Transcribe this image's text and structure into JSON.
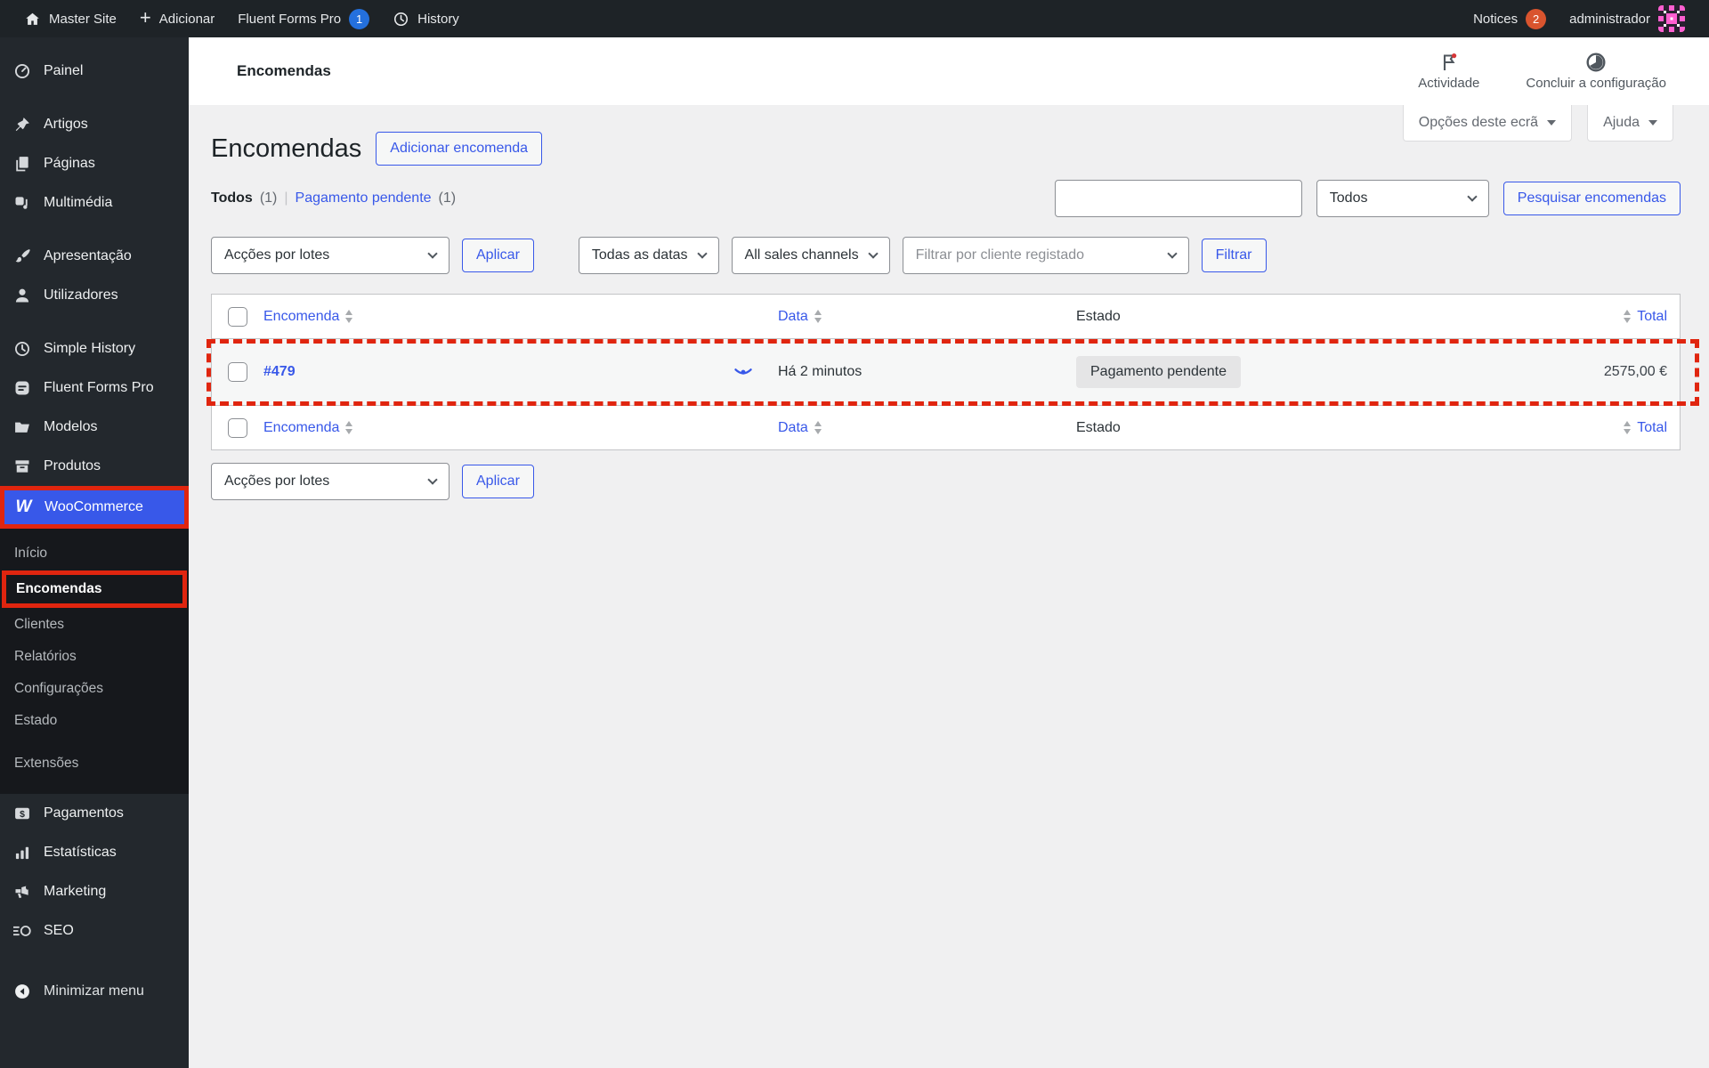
{
  "colors": {
    "accent": "#3858e9",
    "annotation_red": "#e0250f",
    "menu_bg": "#23282d",
    "submenu_bg": "#16181c",
    "adminbar_bg": "#1e2327",
    "page_bg": "#f0f0f1",
    "notice_badge": "#d9542e",
    "ff_badge": "#2470dd",
    "status_badge_bg": "#e5e5e6"
  },
  "icons": {
    "plus_glyph": "+",
    "woocommerce_glyph": "W"
  },
  "admin_bar": {
    "site_name": "Master Site",
    "new_label": "Adicionar",
    "fluent_forms_label": "Fluent Forms Pro",
    "fluent_forms_badge": "1",
    "history_label": "History",
    "notices_label": "Notices",
    "notices_badge": "2",
    "user_name": "administrador"
  },
  "sidebar": {
    "items": [
      "Painel",
      "Artigos",
      "Páginas",
      "Multimédia",
      "Apresentação",
      "Utilizadores",
      "Simple History",
      "Fluent Forms Pro",
      "Modelos",
      "Produtos"
    ],
    "woocommerce_label": "WooCommerce",
    "submenu": [
      "Início",
      "Encomendas",
      "Clientes",
      "Relatórios",
      "Configurações",
      "Estado",
      "Extensões"
    ],
    "bottom": [
      "Pagamentos",
      "Estatísticas",
      "Marketing",
      "SEO"
    ],
    "collapse_label": "Minimizar menu"
  },
  "header": {
    "title": "Encomendas",
    "activity_label": "Actividade",
    "setup_label": "Concluir a configuração",
    "screen_options_label": "Opções deste ecrã",
    "help_label": "Ajuda"
  },
  "page": {
    "title": "Encomendas",
    "add_order_label": "Adicionar encomenda",
    "views": {
      "all_label": "Todos",
      "all_count": "(1)",
      "pending_label": "Pagamento pendente",
      "pending_count": "(1)",
      "separator": "|"
    },
    "search": {
      "input_value": "",
      "select_label": "Todos",
      "button_label": "Pesquisar encomendas"
    },
    "filterbar": {
      "bulk_label": "Acções por lotes",
      "apply_label": "Aplicar",
      "dates_label": "Todas as datas",
      "channels_label": "All sales channels",
      "customer_placeholder": "Filtrar por cliente registado",
      "filter_label": "Filtrar"
    },
    "table": {
      "headers": {
        "order": "Encomenda",
        "date": "Data",
        "status": "Estado",
        "total": "Total"
      },
      "row": {
        "order": "#479",
        "date": "Há 2 minutos",
        "status": "Pagamento pendente",
        "total": "2575,00 €"
      }
    }
  }
}
